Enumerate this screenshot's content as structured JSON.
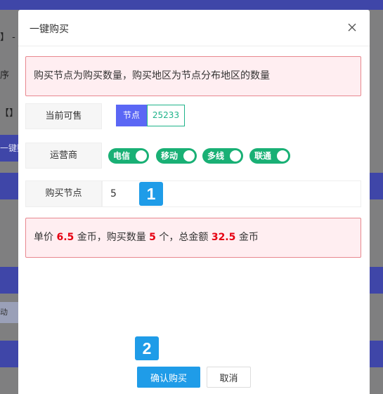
{
  "background": {
    "texts": [
      "】 - ",
      "序",
      "【】",
      "一键购",
      "动"
    ]
  },
  "modal": {
    "title": "一键购买",
    "close_icon": "close-icon"
  },
  "notice": "购买节点为购买数量，购买地区为节点分布地区的数量",
  "available": {
    "label": "当前可售",
    "tag_key": "节点",
    "tag_value": "25233"
  },
  "carrier": {
    "label": "运营商",
    "options": [
      "电信",
      "移动",
      "多线",
      "联通"
    ],
    "on_color": "#19b075"
  },
  "purchase": {
    "label": "购买节点",
    "value": "5"
  },
  "summary": {
    "prefix": "单价",
    "unit_price": "6.5",
    "unit1": "金币，购买数量",
    "quantity": "5",
    "unit2": "个，总金额",
    "total": "32.5",
    "unit3": "金币"
  },
  "badges": [
    "1",
    "2"
  ],
  "buttons": {
    "confirm": "确认购买",
    "cancel": "取消"
  },
  "colors": {
    "primary": "#1f9ce8",
    "tag_blue": "#5b67f5",
    "highlight": "#e60012"
  }
}
